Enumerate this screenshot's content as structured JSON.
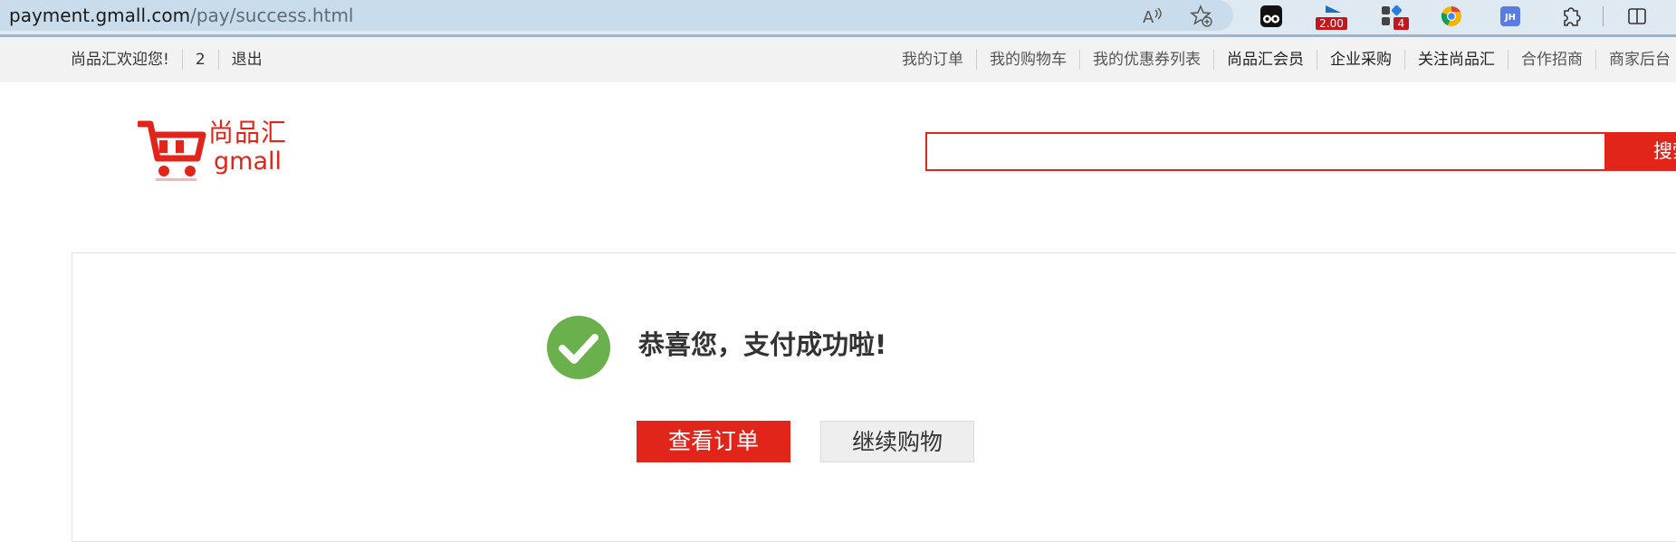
{
  "browser": {
    "url_host": "payment.gmall.com",
    "url_path": "/pay/success.html",
    "extension_badges": {
      "speed": "2.00",
      "count": "4",
      "initials": "JH"
    },
    "icons": [
      "read-aloud-icon",
      "add-favorite-icon",
      "tampermonkey-icon",
      "video-speed-icon",
      "extension-badge-icon",
      "chrome-icon",
      "jh-extension-icon",
      "puzzle-icon",
      "split-screen-icon"
    ]
  },
  "shortcut": {
    "welcome": "尚品汇欢迎您!",
    "user": "2",
    "logout": "退出",
    "links": [
      "我的订单",
      "我的购物车",
      "我的优惠券列表",
      "尚品汇会员",
      "企业采购",
      "关注尚品汇",
      "合作招商",
      "商家后台"
    ]
  },
  "header": {
    "logo_cn": "尚品汇",
    "logo_en": "gmall",
    "search_value": "",
    "search_button": "搜索"
  },
  "success": {
    "title": "恭喜您，支付成功啦!",
    "view_order": "查看订单",
    "continue_shopping": "继续购物"
  },
  "colors": {
    "brand_red": "#e1251b",
    "success_green": "#6ab04c"
  }
}
